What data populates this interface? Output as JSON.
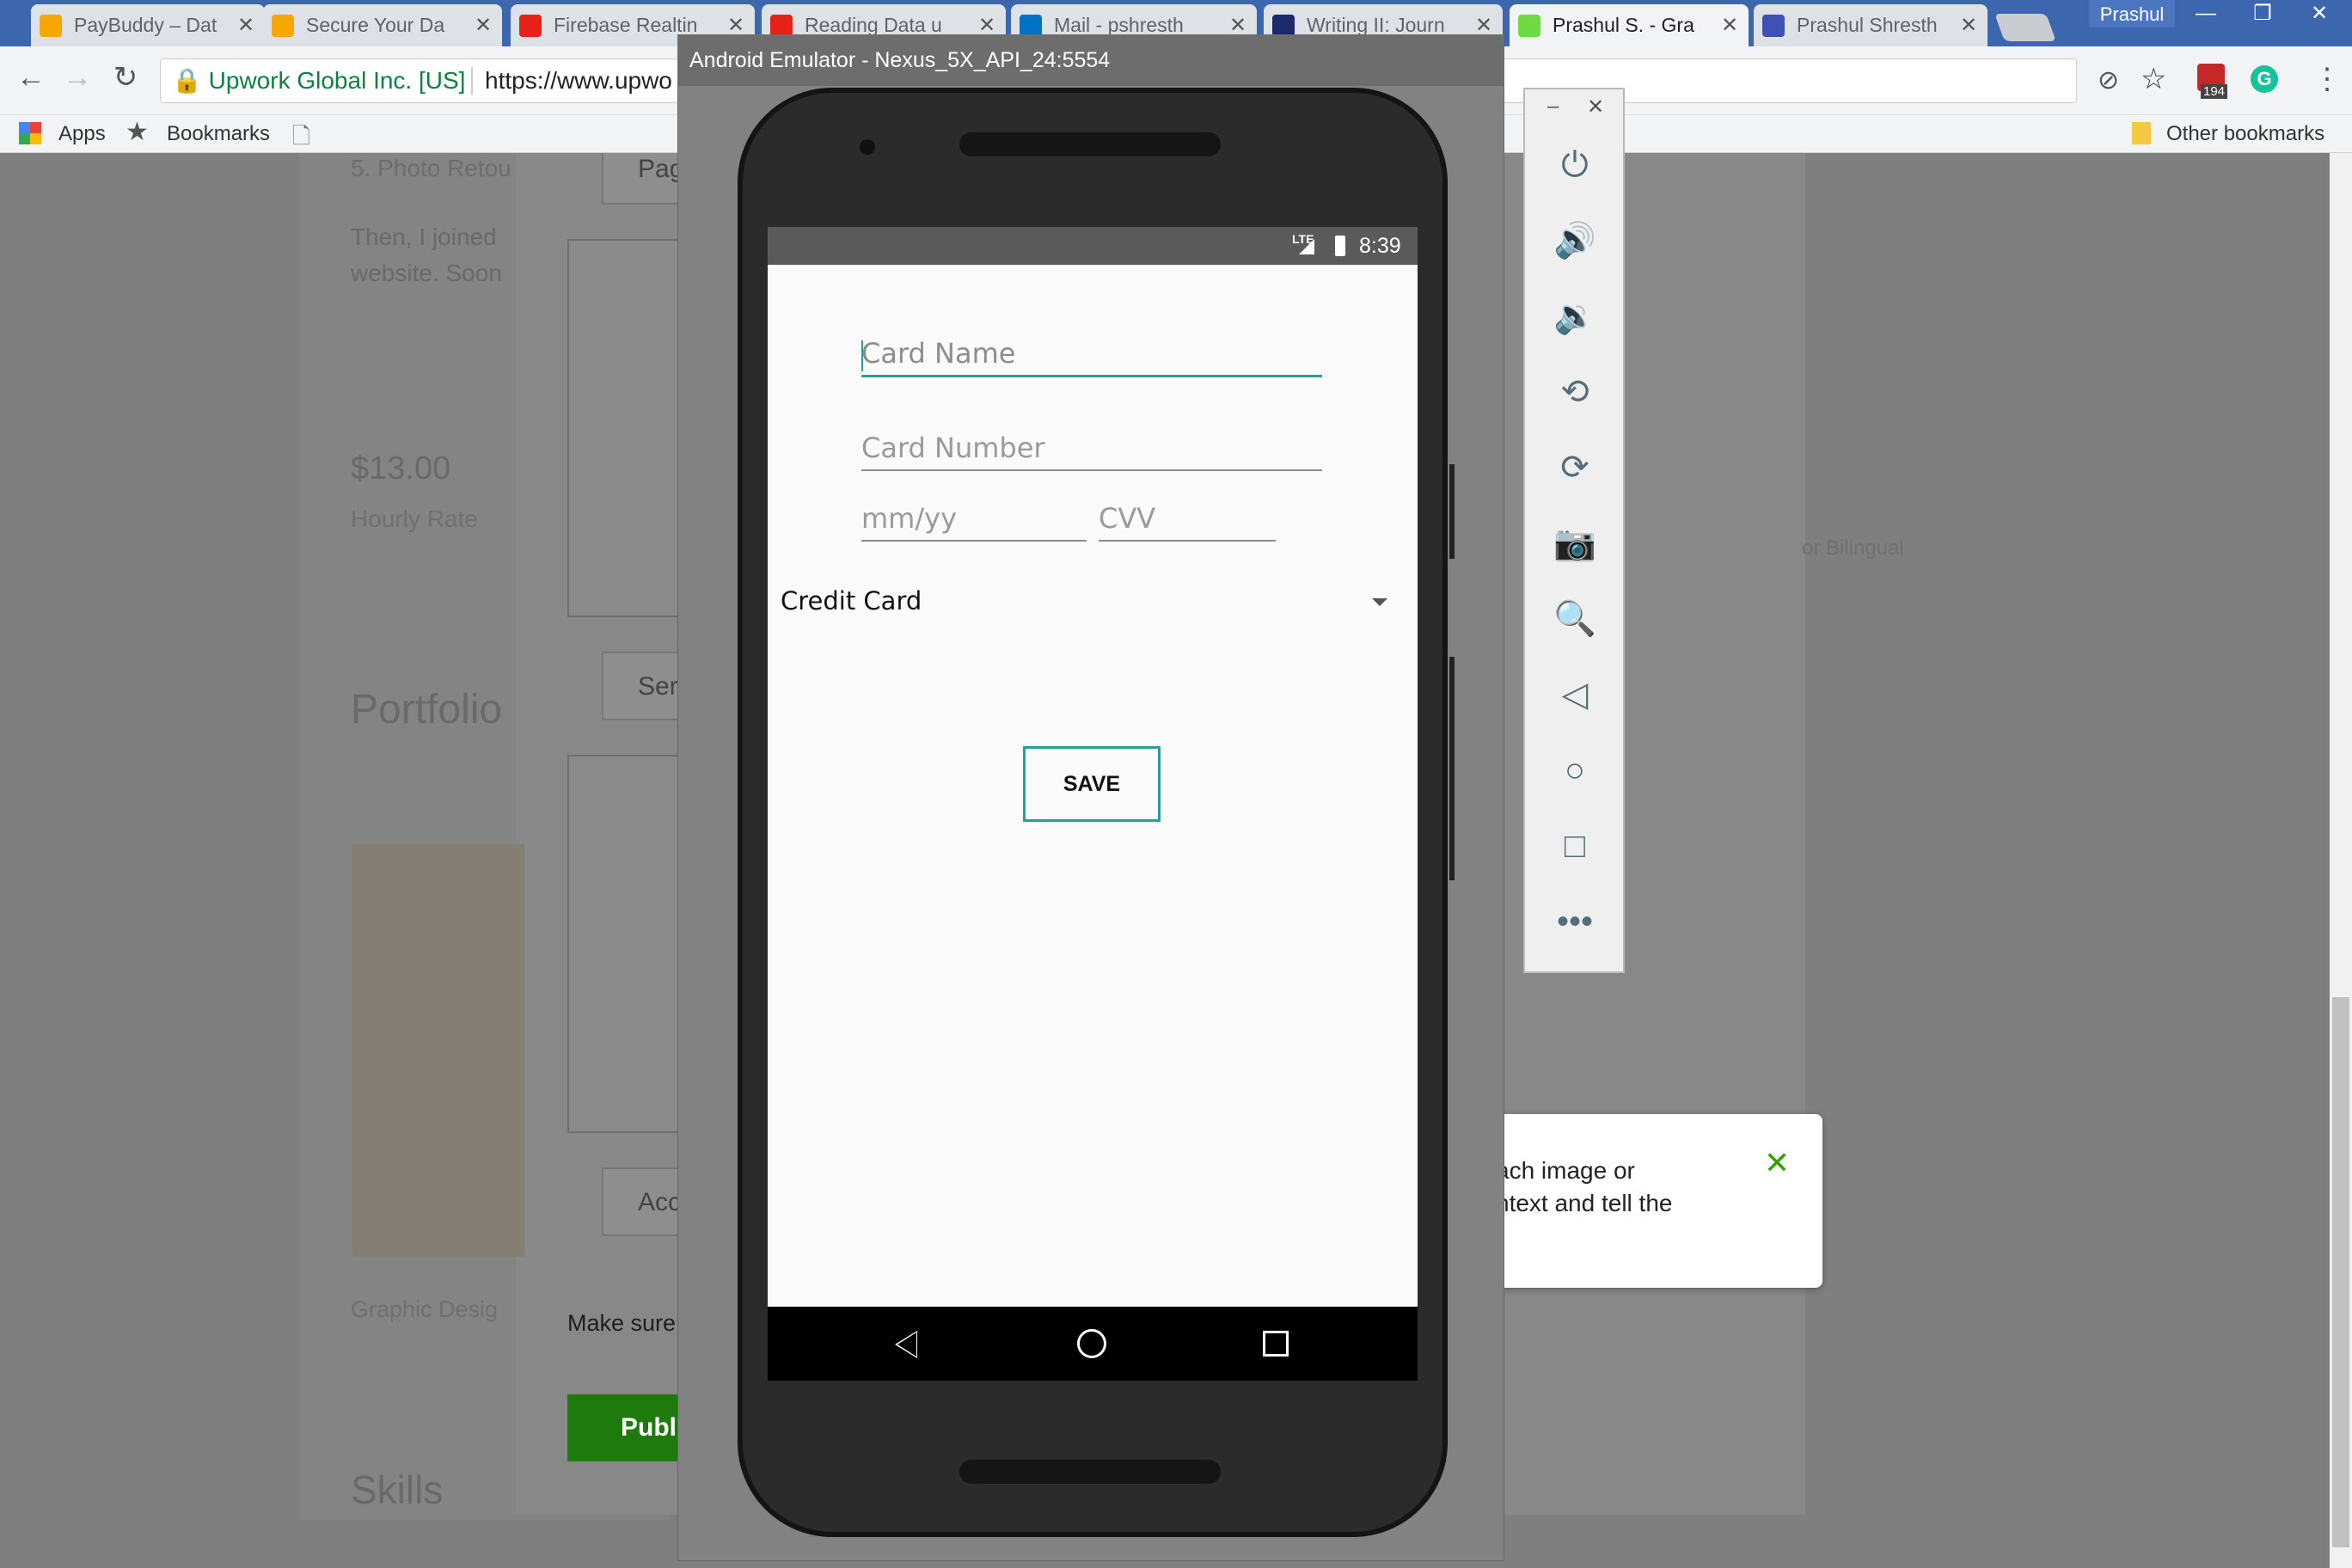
{
  "browser": {
    "tabs": [
      {
        "title": "PayBuddy – Dat",
        "icon": "firebase-icon",
        "color": "#f6a800"
      },
      {
        "title": "Secure Your Da",
        "icon": "firebase-icon",
        "color": "#f6a800"
      },
      {
        "title": "Firebase Realtin",
        "icon": "youtube-icon",
        "color": "#e62117"
      },
      {
        "title": "Reading Data u",
        "icon": "youtube-icon",
        "color": "#e62117"
      },
      {
        "title": "Mail - pshresth",
        "icon": "outlook-icon",
        "color": "#0072c6"
      },
      {
        "title": "Writing II: Journ",
        "icon": "journal-icon",
        "color": "#1b2a6b"
      },
      {
        "title": "Prashul S. - Gra",
        "icon": "upwork-icon",
        "color": "#6fda44"
      },
      {
        "title": "Prashul Shresth",
        "icon": "site-icon",
        "color": "#3f51b5"
      }
    ],
    "profile_name": "Prashul",
    "secure_label": "Upwork Global Inc. [US]",
    "url": "https://www.upwo",
    "bookmarks": {
      "apps": "Apps",
      "bookmarks": "Bookmarks",
      "other": "Other bookmarks"
    },
    "extension_badge": "194"
  },
  "webpage": {
    "text_snippet_1": "5. Photo Retou",
    "btn_page": "Pag",
    "para_line_1": "Then, I joined",
    "para_line_2": "website. Soon",
    "rate": "$13.00",
    "rate_label": "Hourly Rate",
    "right_text": "or Bilingual",
    "btn_ser": "Ser",
    "portfolio": "Portfolio",
    "btn_acc": "Acc",
    "graphic": "Graphic Desig",
    "make_sure": "Make sure",
    "publish": "Publ",
    "skills": "Skills",
    "toast_line_1": "ach image or",
    "toast_line_2": "ntext and tell the"
  },
  "emulator": {
    "title": "Android Emulator - Nexus_5X_API_24:5554",
    "status": {
      "network": "LTE",
      "time": "8:39"
    },
    "form": {
      "card_name_placeholder": "Card Name",
      "card_number_placeholder": "Card Number",
      "expiry_placeholder": "mm/yy",
      "cvv_placeholder": "CVV",
      "card_type": "Credit Card",
      "save_label": "SAVE"
    }
  },
  "accent": "#2a9d9a"
}
